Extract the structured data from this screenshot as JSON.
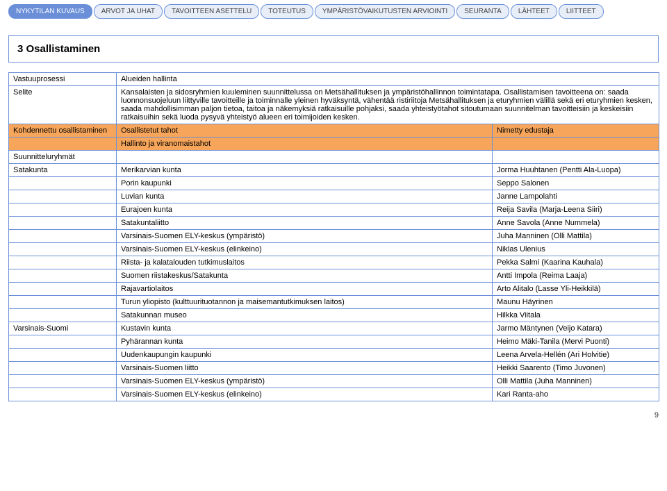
{
  "tabs": [
    {
      "label": "NYKYTILAN KUVAUS"
    },
    {
      "label": "ARVOT JA UHAT"
    },
    {
      "label": "TAVOITTEEN ASETTELU"
    },
    {
      "label": "TOTEUTUS"
    },
    {
      "label": "YMPÄRISTÖVAIKUTUSTEN ARVIOINTI"
    },
    {
      "label": "SEURANTA"
    },
    {
      "label": "LÄHTEET"
    },
    {
      "label": "LIITTEET"
    }
  ],
  "heading": "3 Osallistaminen",
  "intro": {
    "responsibility_label": "Vastuuprosessi",
    "responsibility_value": "Alueiden hallinta",
    "description_label": "Selite",
    "description_value": "Kansalaisten ja sidosryhmien kuuleminen suunnittelussa on Metsähallituksen ja ympäristöhallinnon toimintatapa. Osallistamisen tavoitteena on: saada luonnonsuojeluun liittyville tavoitteille ja toiminnalle yleinen hyväksyntä, vähentää ristiriitoja Metsähallituksen ja eturyhmien välillä sekä eri eturyhmien kesken, saada mahdollisimman paljon tietoa, taitoa ja näkemyksiä ratkaisuille pohjaksi, saada yhteistyötahot sitoutumaan suunnitelman tavoitteisiin ja keskeisiin ratkaisuihin sekä luoda pysyvä yhteistyö alueen eri toimijoiden kesken."
  },
  "headers": {
    "col1": "Kohdennettu osallistaminen",
    "col2": "Osallistetut tahot",
    "col3": "Nimetty edustaja"
  },
  "section_header": "Hallinto ja viranomaistahot",
  "groups_label": "Suunnitteluryhmät",
  "rows": [
    {
      "group": "Satakunta",
      "entity": "Merikarvian kunta",
      "rep": "Jorma Huuhtanen (Pentti Ala-Luopa)"
    },
    {
      "group": "",
      "entity": "Porin kaupunki",
      "rep": "Seppo Salonen"
    },
    {
      "group": "",
      "entity": "Luvian kunta",
      "rep": "Janne Lampolahti"
    },
    {
      "group": "",
      "entity": "Eurajoen kunta",
      "rep": "Reija Savila (Marja-Leena Siiri)"
    },
    {
      "group": "",
      "entity": "Satakuntaliitto",
      "rep": "Anne Savola (Anne Nummela)"
    },
    {
      "group": "",
      "entity": "Varsinais-Suomen ELY-keskus (ympäristö)",
      "rep": "Juha Manninen (Olli Mattila)"
    },
    {
      "group": "",
      "entity": "Varsinais-Suomen ELY-keskus (elinkeino)",
      "rep": "Niklas Ulenius"
    },
    {
      "group": "",
      "entity": "Riista- ja kalatalouden tutkimuslaitos",
      "rep": "Pekka Salmi (Kaarina Kauhala)"
    },
    {
      "group": "",
      "entity": "Suomen riistakeskus/Satakunta",
      "rep": "Antti Impola (Reima Laaja)"
    },
    {
      "group": "",
      "entity": "Rajavartiolaitos",
      "rep": "Arto Alitalo (Lasse Yli-Heikkilä)"
    },
    {
      "group": "",
      "entity": "Turun yliopisto (kulttuurituotannon ja maisemantutkimuksen laitos)",
      "rep": "Maunu Häyrinen"
    },
    {
      "group": "",
      "entity": "Satakunnan museo",
      "rep": "Hilkka Viitala"
    },
    {
      "group": "Varsinais-Suomi",
      "entity": "Kustavin kunta",
      "rep": "Jarmo Mäntynen (Veijo Katara)"
    },
    {
      "group": "",
      "entity": "Pyhärannan kunta",
      "rep": "Heimo Mäki-Tanila (Mervi Puonti)"
    },
    {
      "group": "",
      "entity": "Uudenkaupungin kaupunki",
      "rep": "Leena Arvela-Hellén (Ari Holvitie)"
    },
    {
      "group": "",
      "entity": "Varsinais-Suomen liitto",
      "rep": "Heikki Saarento (Timo Juvonen)"
    },
    {
      "group": "",
      "entity": "Varsinais-Suomen ELY-keskus (ympäristö)",
      "rep": "Olli Mattila (Juha Manninen)"
    },
    {
      "group": "",
      "entity": "Varsinais-Suomen ELY-keskus (elinkeino)",
      "rep": "Kari Ranta-aho"
    }
  ],
  "page_number": "9"
}
